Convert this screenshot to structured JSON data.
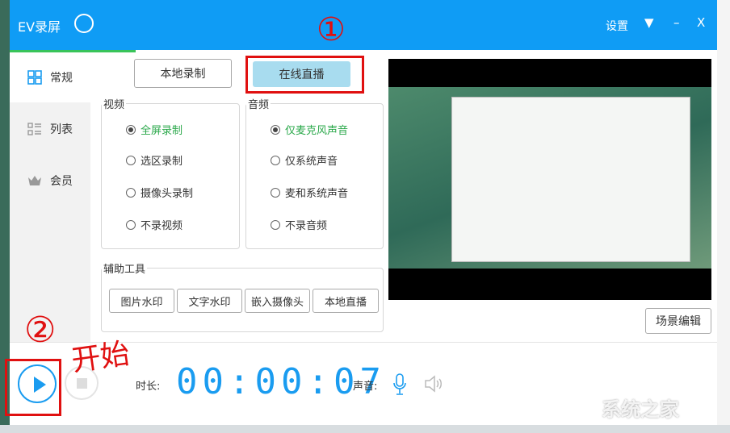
{
  "title_bar": {
    "app_name": "EV录屏",
    "settings_label": "设置",
    "menu_icon": "▼",
    "minimize": "–",
    "close": "X"
  },
  "sidebar": {
    "items": [
      {
        "label": "常规",
        "icon": "grid-icon",
        "active": true
      },
      {
        "label": "列表",
        "icon": "list-icon"
      },
      {
        "label": "会员",
        "icon": "crown-icon"
      }
    ]
  },
  "mode_tabs": {
    "local": "本地录制",
    "live": "在线直播"
  },
  "video": {
    "label": "视频",
    "options": [
      "全屏录制",
      "选区录制",
      "摄像头录制",
      "不录视频"
    ],
    "selected": 0
  },
  "audio": {
    "label": "音频",
    "options": [
      "仅麦克风声音",
      "仅系统声音",
      "麦和系统声音",
      "不录音频"
    ],
    "selected": 0
  },
  "tools": {
    "label": "辅助工具",
    "buttons": [
      "图片水印",
      "文字水印",
      "嵌入摄像头",
      "本地直播"
    ]
  },
  "scene_edit": "场景编辑",
  "bottom": {
    "duration_label": "时长:",
    "timer": "00:00:07",
    "sound_label": "声音:"
  },
  "annotations": {
    "one": "①",
    "two": "②",
    "start": "开始"
  },
  "watermark": "系统之家",
  "colors": {
    "accent": "#0f9cf5",
    "selected_green": "#2aa84a",
    "annotation_red": "#e01010"
  }
}
